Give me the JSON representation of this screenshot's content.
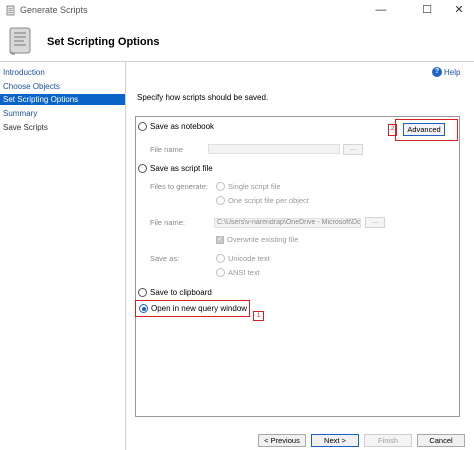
{
  "window": {
    "title": "Generate Scripts",
    "minimize": "—",
    "maximize": "☐",
    "close": "✕"
  },
  "header": {
    "title": "Set Scripting Options"
  },
  "sidebar": {
    "items": [
      {
        "label": "Introduction"
      },
      {
        "label": "Choose Objects"
      },
      {
        "label": "Set Scripting Options"
      },
      {
        "label": "Summary"
      },
      {
        "label": "Save Scripts"
      }
    ]
  },
  "help": {
    "label": "Help",
    "icon": "?"
  },
  "main": {
    "instruction": "Specify how scripts should be saved.",
    "notebook": {
      "label": "Save as notebook",
      "file_name_label": "File name",
      "browse": "..."
    },
    "script_file": {
      "label": "Save as script file",
      "files_label": "Files to generate:",
      "single": "Single script file",
      "per_object": "One script file per object",
      "file_name_label": "File name:",
      "file_name_value": "C:\\Users\\v-narendrap\\OneDrive - Microsoft\\Do",
      "browse": "...",
      "overwrite": "Overwrite existing file",
      "save_as_label": "Save as:",
      "unicode": "Unicode text",
      "ansi": "ANSI text"
    },
    "clipboard": {
      "label": "Save to clipboard"
    },
    "query_window": {
      "label": "Open in new query window"
    },
    "advanced_label": "Advanced"
  },
  "markers": {
    "advanced": "2",
    "query": "1"
  },
  "footer": {
    "previous": "< Previous",
    "next": "Next >",
    "finish": "Finish",
    "cancel": "Cancel"
  }
}
